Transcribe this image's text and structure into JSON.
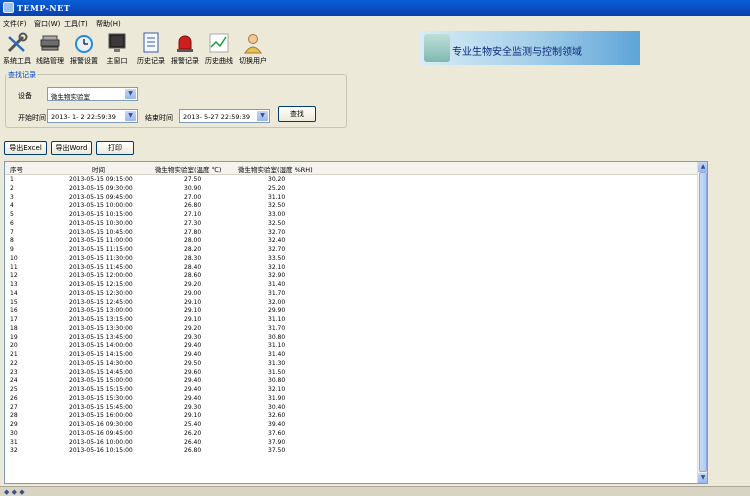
{
  "window": {
    "title": "TEMP-NET"
  },
  "menu": [
    "文件(F)",
    "窗口(W)",
    "工具(T)",
    "帮助(H)"
  ],
  "toolbar": [
    {
      "label": "系统工具",
      "icon": "wrench-tools-icon"
    },
    {
      "label": "线路管理",
      "icon": "network-device-icon"
    },
    {
      "label": "报警设置",
      "icon": "alarm-clock-icon"
    },
    {
      "label": "主窗口",
      "icon": "monitor-icon"
    },
    {
      "label": "历史记录",
      "icon": "document-list-icon"
    },
    {
      "label": "报警记录",
      "icon": "red-siren-icon"
    },
    {
      "label": "历史曲线",
      "icon": "line-graph-icon"
    },
    {
      "label": "切换用户",
      "icon": "user-person-icon"
    }
  ],
  "banner": {
    "text": "专业生物安全监测与控制领域"
  },
  "query": {
    "group_title": "查找记录",
    "device_label": "设备",
    "device_value": "微生物实验室",
    "start_label": "开始时间",
    "start_value": "2013- 1- 2 22:59:39",
    "end_label": "结束时间",
    "end_value": "2013- 5-27 22:59:39",
    "search_button": "查找"
  },
  "actions": {
    "export_excel": "导出Excel",
    "export_word": "导出Word",
    "print": "打印"
  },
  "table": {
    "headers": [
      "序号",
      "时间",
      "微生物实验室(温度 ℃)",
      "微生物实验室(湿度 %RH)"
    ],
    "rows": [
      [
        "1",
        "2013-05-15 09:15:00",
        "27.50",
        "30.20"
      ],
      [
        "2",
        "2013-05-15 09:30:00",
        "30.90",
        "25.20"
      ],
      [
        "3",
        "2013-05-15 09:45:00",
        "27.00",
        "31.10"
      ],
      [
        "4",
        "2013-05-15 10:00:00",
        "26.80",
        "32.50"
      ],
      [
        "5",
        "2013-05-15 10:15:00",
        "27.10",
        "33.00"
      ],
      [
        "6",
        "2013-05-15 10:30:00",
        "27.30",
        "32.50"
      ],
      [
        "7",
        "2013-05-15 10:45:00",
        "27.80",
        "32.70"
      ],
      [
        "8",
        "2013-05-15 11:00:00",
        "28.00",
        "32.40"
      ],
      [
        "9",
        "2013-05-15 11:15:00",
        "28.20",
        "32.70"
      ],
      [
        "10",
        "2013-05-15 11:30:00",
        "28.30",
        "33.50"
      ],
      [
        "11",
        "2013-05-15 11:45:00",
        "28.40",
        "32.10"
      ],
      [
        "12",
        "2013-05-15 12:00:00",
        "28.60",
        "32.90"
      ],
      [
        "13",
        "2013-05-15 12:15:00",
        "29.20",
        "31.40"
      ],
      [
        "14",
        "2013-05-15 12:30:00",
        "29.00",
        "31.70"
      ],
      [
        "15",
        "2013-05-15 12:45:00",
        "29.10",
        "32.00"
      ],
      [
        "16",
        "2013-05-15 13:00:00",
        "29.10",
        "29.90"
      ],
      [
        "17",
        "2013-05-15 13:15:00",
        "29.10",
        "31.10"
      ],
      [
        "18",
        "2013-05-15 13:30:00",
        "29.20",
        "31.70"
      ],
      [
        "19",
        "2013-05-15 13:45:00",
        "29.30",
        "30.80"
      ],
      [
        "20",
        "2013-05-15 14:00:00",
        "29.40",
        "31.10"
      ],
      [
        "21",
        "2013-05-15 14:15:00",
        "29.40",
        "31.40"
      ],
      [
        "22",
        "2013-05-15 14:30:00",
        "29.50",
        "31.30"
      ],
      [
        "23",
        "2013-05-15 14:45:00",
        "29.60",
        "31.50"
      ],
      [
        "24",
        "2013-05-15 15:00:00",
        "29.40",
        "30.80"
      ],
      [
        "25",
        "2013-05-15 15:15:00",
        "29.40",
        "32.10"
      ],
      [
        "26",
        "2013-05-15 15:30:00",
        "29.40",
        "31.90"
      ],
      [
        "27",
        "2013-05-15 15:45:00",
        "29.30",
        "30.40"
      ],
      [
        "28",
        "2013-05-15 16:00:00",
        "29.10",
        "32.60"
      ],
      [
        "29",
        "2013-05-16 09:30:00",
        "25.40",
        "39.40"
      ],
      [
        "30",
        "2013-05-16 09:45:00",
        "26.20",
        "37.60"
      ],
      [
        "31",
        "2013-05-16 10:00:00",
        "26.40",
        "37.90"
      ],
      [
        "32",
        "2013-05-16 10:15:00",
        "26.80",
        "37.50"
      ]
    ]
  }
}
